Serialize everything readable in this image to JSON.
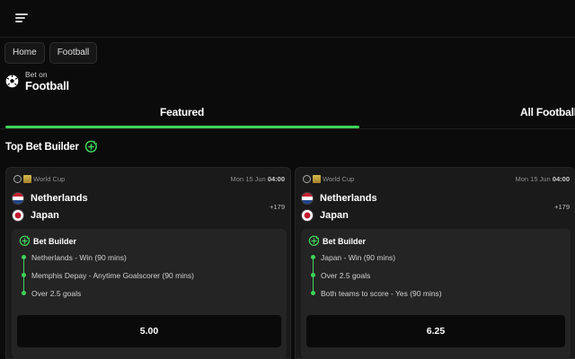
{
  "breadcrumb": [
    "Home",
    "Football"
  ],
  "heading": {
    "small": "Bet on",
    "big": "Football"
  },
  "tabs": {
    "featured": "Featured",
    "all": "All Football"
  },
  "section": {
    "title": "Top Bet Builder"
  },
  "colors": {
    "accent": "#3fd35a",
    "background": "#0b0b0b",
    "card": "#1a1a1a"
  },
  "icons": {
    "menu": "menu-icon",
    "ball": "soccer-ball-icon",
    "builder": "bet-builder-plus-icon"
  },
  "cards": [
    {
      "competition": "World Cup",
      "date": "Mon 15 Jun",
      "time": "04:00",
      "team1": "Netherlands",
      "team2": "Japan",
      "more_markets": "+179",
      "builder_title": "Bet Builder",
      "legs": [
        "Netherlands - Win (90 mins)",
        "Memphis Depay - Anytime Goalscorer (90 mins)",
        "Over 2.5 goals"
      ],
      "odds": "5.00"
    },
    {
      "competition": "World Cup",
      "date": "Mon 15 Jun",
      "time": "04:00",
      "team1": "Netherlands",
      "team2": "Japan",
      "more_markets": "+179",
      "builder_title": "Bet Builder",
      "legs": [
        "Japan - Win (90 mins)",
        "Over 2.5 goals",
        "Both teams to score - Yes (90 mins)"
      ],
      "odds": "6.25"
    }
  ]
}
